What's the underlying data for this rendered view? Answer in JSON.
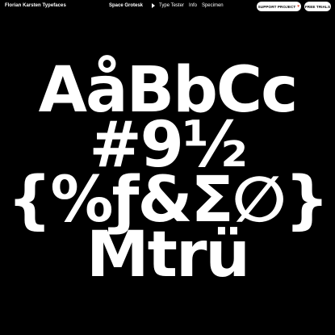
{
  "header": {
    "brand": "Florian Karsten Typefaces",
    "family_name": "Space Grotesk",
    "nav_links": [
      "Type Tester",
      "Info",
      "Specimen"
    ],
    "support_label": "SUPPORT PROJECT",
    "support_icon": "heart-icon",
    "trials_label": "FREE TRIALS"
  },
  "specimen": {
    "lines": [
      "AåBbCc",
      "#9½",
      "{%ƒ&Σ∅}",
      "Mtrü"
    ]
  },
  "colors": {
    "background": "#000000",
    "foreground": "#ffffff",
    "button_bg": "#ffffff",
    "button_text": "#000000"
  }
}
